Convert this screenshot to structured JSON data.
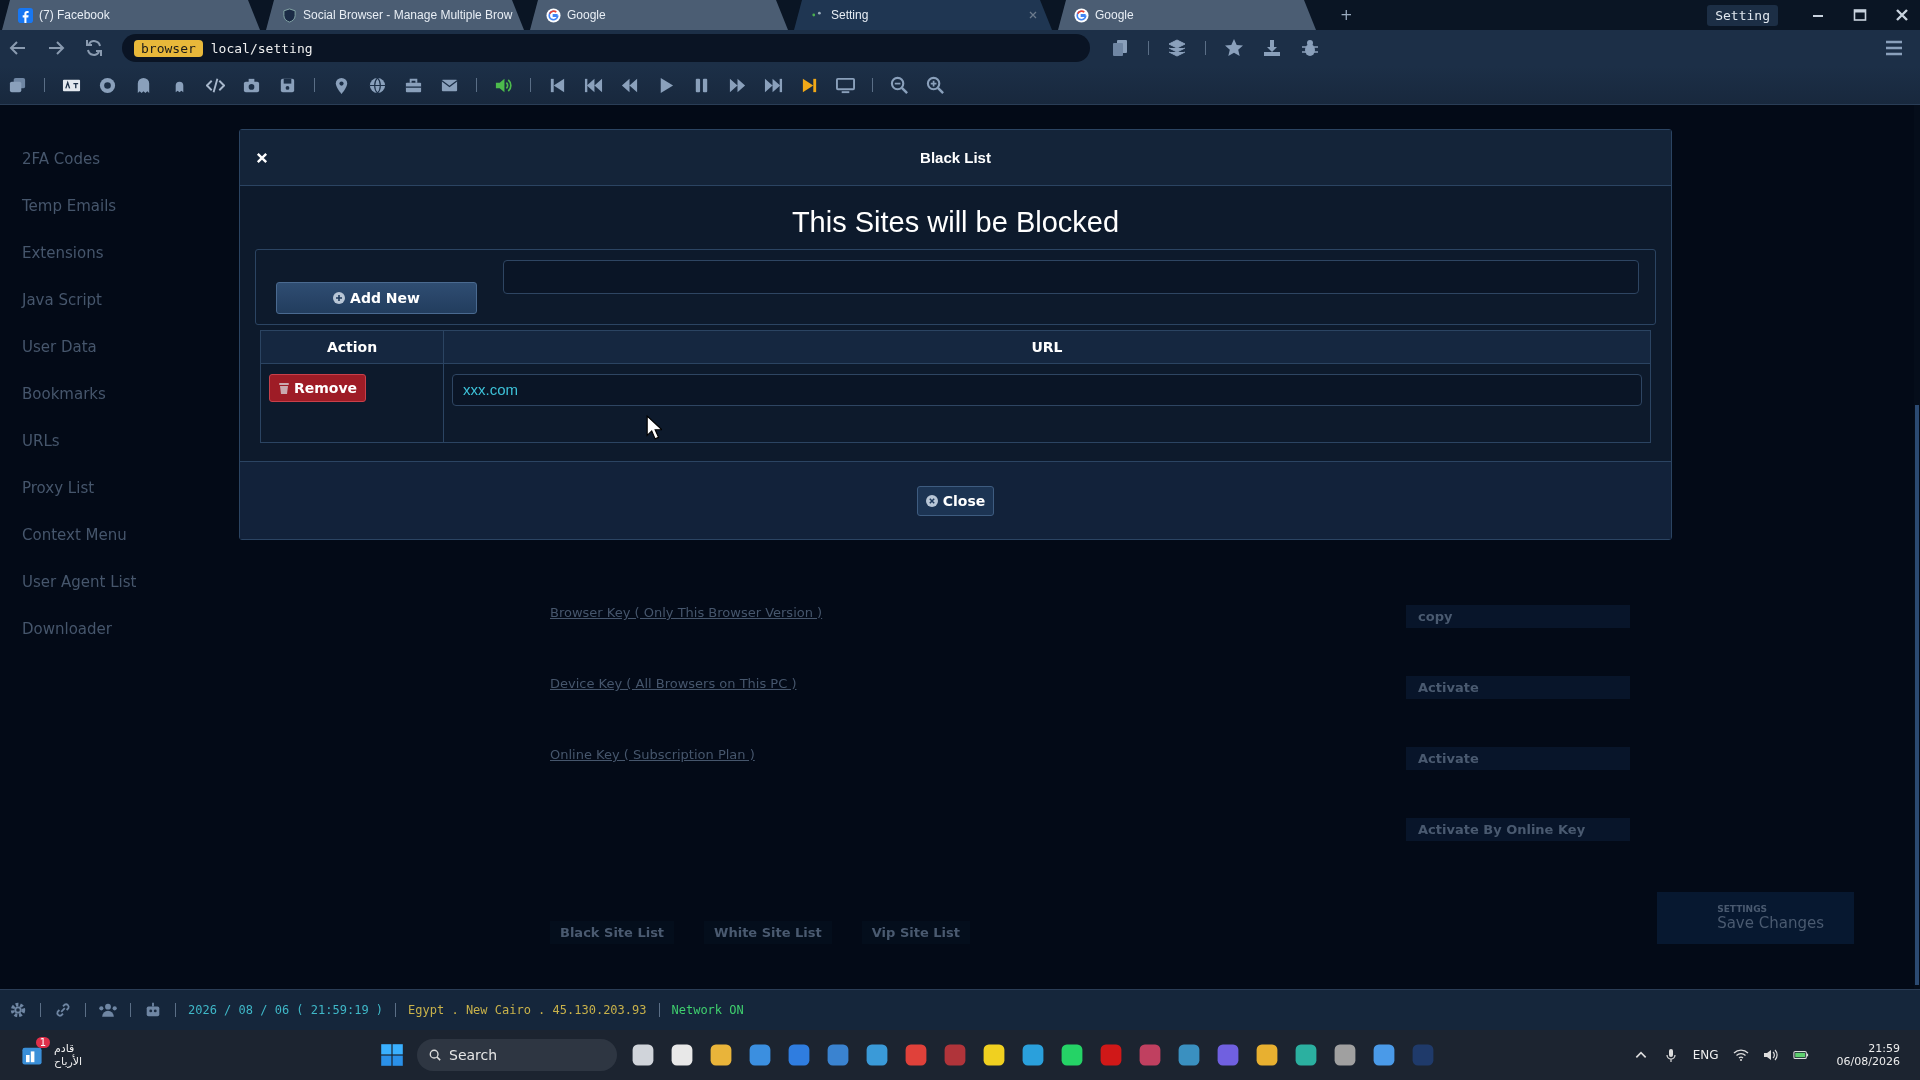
{
  "tabs": [
    {
      "label": "(7) Facebook",
      "selected": false
    },
    {
      "label": "Social Browser - Manage Multiple Brow",
      "selected": false
    },
    {
      "label": "Google",
      "selected": false
    },
    {
      "label": "Setting",
      "selected": true
    },
    {
      "label": "Google",
      "selected": false
    }
  ],
  "new_tab": "+",
  "window_badge": "Setting",
  "address": {
    "tag": "browser",
    "url": "local/setting"
  },
  "sidebar": {
    "items": [
      "2FA Codes",
      "Temp Emails",
      "Extensions",
      "Java Script",
      "User Data",
      "Bookmarks",
      "URLs",
      "Proxy List",
      "Context Menu",
      "User Agent List",
      "Downloader"
    ]
  },
  "background": {
    "keys": [
      {
        "label": "Browser Key ( Only This Browser Version )",
        "button": "copy"
      },
      {
        "label": "Device Key ( All Browsers on This PC )",
        "button": "Activate"
      },
      {
        "label": "Online Key ( Subscription Plan )",
        "button": "Activate"
      }
    ],
    "online_button": "Activate By Online Key",
    "list_tabs": [
      "Black Site List",
      "White Site List",
      "Vip Site List"
    ],
    "save": {
      "caption": "SETTINGS",
      "label": "Save Changes"
    }
  },
  "modal": {
    "title": "Black List",
    "heading": "This Sites will be Blocked",
    "add_button": "Add New",
    "columns": [
      "Action",
      "URL"
    ],
    "rows": [
      {
        "action": "Remove",
        "url": "xxx.com"
      }
    ],
    "close_button": "Close"
  },
  "status_bar": {
    "datetime": "2026 / 08 / 06 ( 21:59:19 )",
    "location": "Egypt . New Cairo . 45.130.203.93",
    "network": "Network ON"
  },
  "taskbar": {
    "weather_badge": "1",
    "weather_line1": "قادم",
    "weather_line2": "الأرباح",
    "search_placeholder": "Search",
    "language": "ENG",
    "time": "21:59",
    "date": "06/08/2026"
  }
}
